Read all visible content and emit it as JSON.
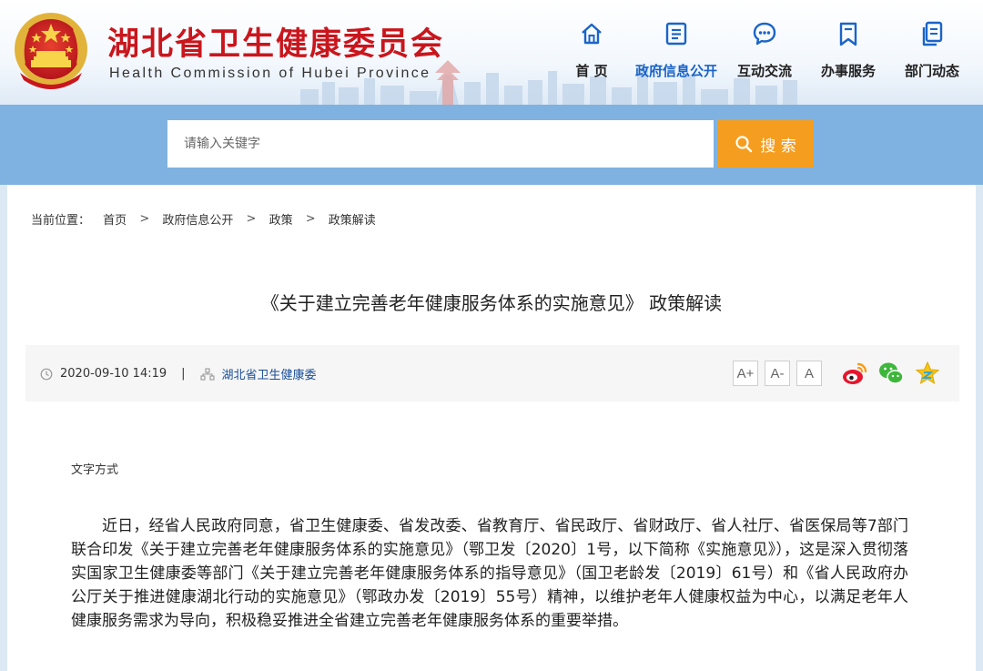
{
  "header": {
    "title": "湖北省卫生健康委员会",
    "subtitle": "Health Commission of Hubei Province",
    "brand_color": "#c9161d"
  },
  "nav": {
    "items": [
      {
        "label": "首 页",
        "icon": "home-icon"
      },
      {
        "label": "政府信息公开",
        "icon": "document-list-icon",
        "active": true
      },
      {
        "label": "互动交流",
        "icon": "chat-bubble-icon"
      },
      {
        "label": "办事服务",
        "icon": "bookmark-icon"
      },
      {
        "label": "部门动态",
        "icon": "copy-documents-icon"
      }
    ],
    "active_color": "#1a64c8"
  },
  "search": {
    "placeholder": "请输入关键字",
    "button_label": "搜 索",
    "button_color": "#f59d1f"
  },
  "breadcrumb": {
    "prefix": "当前位置：",
    "items": [
      "首页",
      "政府信息公开",
      "政策",
      "政策解读"
    ],
    "separator": ">"
  },
  "article": {
    "title": "《关于建立完善老年健康服务体系的实施意见》 政策解读",
    "date": "2020-09-10 14:19",
    "meta_separator": "|",
    "publisher": "湖北省卫生健康委",
    "text_mode_label": "文字方式",
    "body": "近日，经省人民政府同意，省卫生健康委、省发改委、省教育厅、省民政厅、省财政厅、省人社厅、省医保局等7部门联合印发《关于建立完善老年健康服务体系的实施意见》（鄂卫发〔2020〕1号，以下简称《实施意见》），这是深入贯彻落实国家卫生健康委等部门《关于建立完善老年健康服务体系的指导意见》（国卫老龄发〔2019〕61号）和《省人民政府办公厅关于推进健康湖北行动的实施意见》（鄂政办发〔2019〕55号）精神，以维护老年人健康权益为中心，以满足老年人健康服务需求为导向，积极稳妥推进全省建立完善老年健康服务体系的重要举措。"
  },
  "font_controls": {
    "increase": "A+",
    "decrease": "A-",
    "default": "A"
  },
  "share": {
    "icons": [
      "weibo-icon",
      "wechat-icon",
      "favorite-star-icon"
    ]
  }
}
